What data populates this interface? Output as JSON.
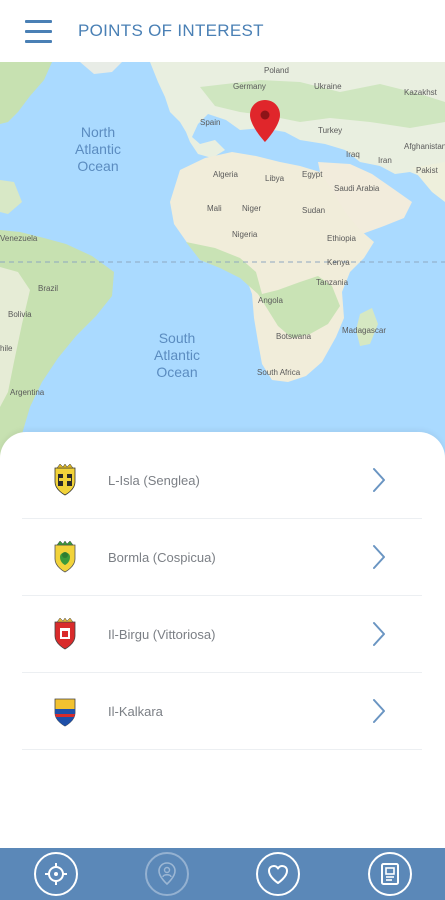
{
  "header": {
    "title": "POINTS OF INTEREST"
  },
  "map": {
    "labels": {
      "poland": "Poland",
      "germany": "Germany",
      "ukraine": "Ukraine",
      "kazakhstan": "Kazakhst",
      "spain": "Spain",
      "turkey": "Turkey",
      "iraq": "Iraq",
      "afghanistan": "Afghanistan",
      "pakistan": "Pakist",
      "iran": "Iran",
      "algeria": "Algeria",
      "libya": "Libya",
      "egypt": "Egypt",
      "saudi": "Saudi Arabia",
      "mali": "Mali",
      "niger": "Niger",
      "sudan": "Sudan",
      "nigeria": "Nigeria",
      "ethiopia": "Ethiopia",
      "kenya": "Kenya",
      "tanzania": "Tanzania",
      "angola": "Angola",
      "botswana": "Botswana",
      "madagascar": "Madagascar",
      "south_africa": "South Africa",
      "venezuela": "Venezuela",
      "brazil": "Brazil",
      "bolivia": "Bolivia",
      "hile": "hile",
      "argentina": "Argentina"
    },
    "north_atlantic": [
      "North",
      "Atlantic",
      "Ocean"
    ],
    "south_atlantic": [
      "South",
      "Atlantic",
      "Ocean"
    ]
  },
  "poi_list": [
    {
      "label": "L-Isla (Senglea)"
    },
    {
      "label": "Bormla (Cospicua)"
    },
    {
      "label": "Il-Birgu (Vittoriosa)"
    },
    {
      "label": "Il-Kalkara"
    }
  ],
  "bottom_nav": {
    "items": [
      {
        "icon": "crosshair-icon"
      },
      {
        "icon": "user-location-icon"
      },
      {
        "icon": "heart-icon"
      },
      {
        "icon": "guide-book-icon"
      }
    ]
  }
}
